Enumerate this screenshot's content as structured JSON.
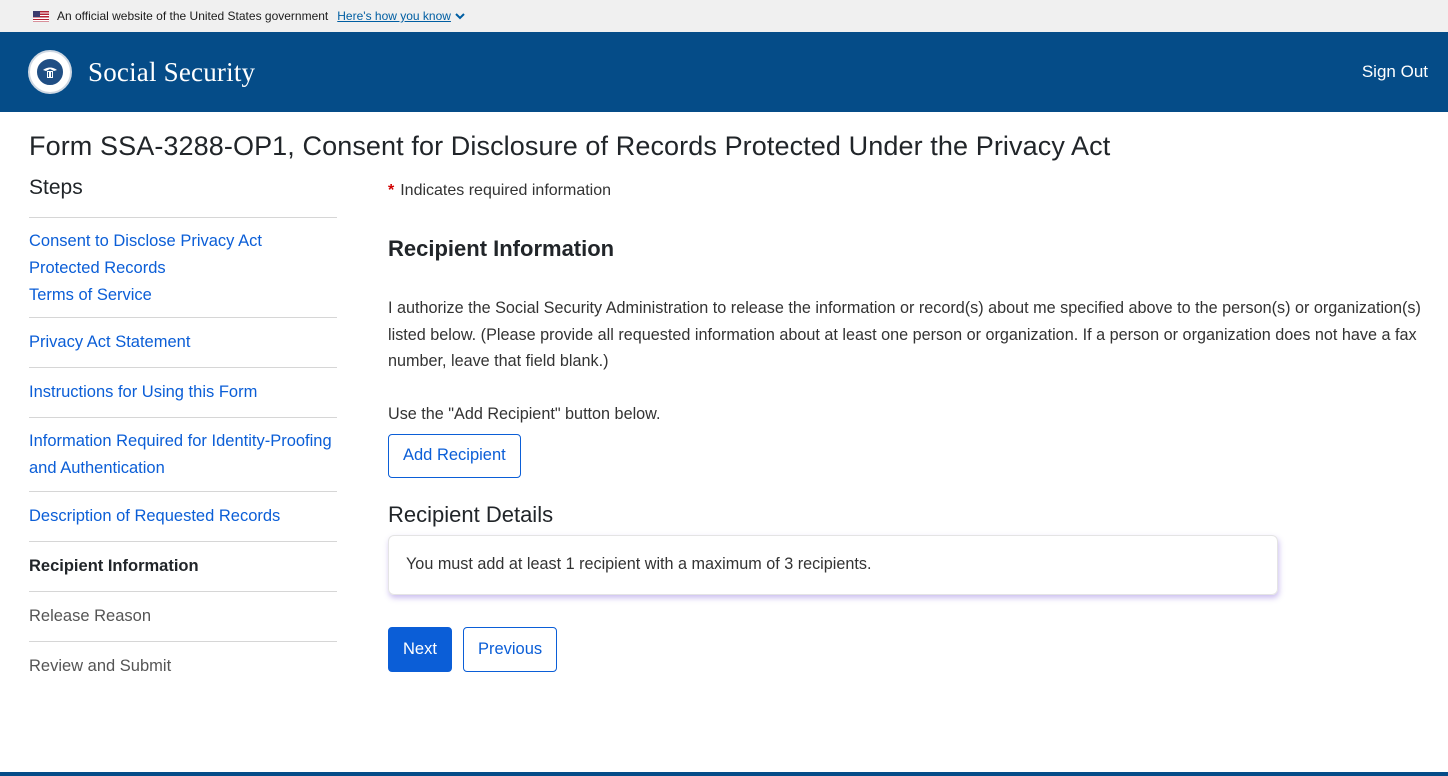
{
  "gov_banner": {
    "text": "An official website of the United States government",
    "link": "Here's how you know"
  },
  "header": {
    "brand": "Social Security",
    "sign_out": "Sign Out"
  },
  "page_title": "Form SSA-3288-OP1, Consent for Disclosure of Records Protected Under the Privacy Act",
  "sidebar": {
    "title": "Steps",
    "steps": [
      {
        "label": "Consent to Disclose Privacy Act Protected Records",
        "state": "link"
      },
      {
        "label": "Terms of Service",
        "state": "link"
      },
      {
        "label": "Privacy Act Statement",
        "state": "link"
      },
      {
        "label": "Instructions for Using this Form",
        "state": "link"
      },
      {
        "label": "Information Required for Identity-Proofing and Authentication",
        "state": "link"
      },
      {
        "label": "Description of Requested Records",
        "state": "link"
      },
      {
        "label": "Recipient Information",
        "state": "current"
      },
      {
        "label": "Release Reason",
        "state": "disabled"
      },
      {
        "label": "Review and Submit",
        "state": "disabled"
      }
    ]
  },
  "main": {
    "required_asterisk": "*",
    "required_note": "Indicates required information",
    "section_heading": "Recipient Information",
    "authorization_text": "I authorize the Social Security Administration to release the information or record(s) about me specified above to the person(s) or organization(s) listed below. (Please provide all requested information about at least one person or organization. If a person or organization does not have a fax number, leave that field blank.)",
    "use_note": "Use the \"Add Recipient\" button below.",
    "add_recipient_label": "Add Recipient",
    "details_heading": "Recipient Details",
    "details_alert": "You must add at least 1 recipient with a maximum of 3 recipients.",
    "next_label": "Next",
    "previous_label": "Previous"
  },
  "colors": {
    "header_bg": "#054c88",
    "link": "#0b5ed7",
    "required": "#d10000",
    "banner_bg": "#f0f0f0"
  }
}
